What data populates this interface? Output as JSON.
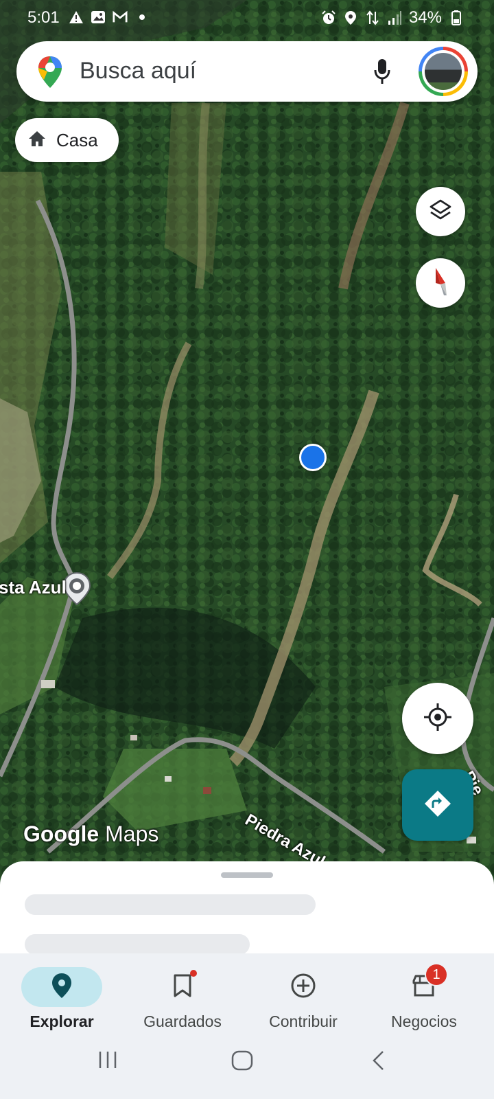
{
  "status_bar": {
    "time": "5:01",
    "battery": "34%",
    "left_icons": [
      "warning-icon",
      "image-icon",
      "gmail-icon",
      "dot-icon"
    ],
    "right_icons": [
      "alarm-icon",
      "location-icon",
      "data-arrows-icon",
      "signal-icon",
      "battery-icon"
    ]
  },
  "search": {
    "placeholder": "Busca aquí"
  },
  "chip": {
    "label": "Casa"
  },
  "map": {
    "place_label": "sta Azul",
    "road_label": "Piedra Azul Alto",
    "road_label_partial": "Pie",
    "watermark_brand": "Google",
    "watermark_product": "Maps"
  },
  "bottom_nav": {
    "items": [
      {
        "label": "Explorar",
        "icon": "explore-pin-icon",
        "active": true
      },
      {
        "label": "Guardados",
        "icon": "bookmark-icon",
        "active": false
      },
      {
        "label": "Contribuir",
        "icon": "add-circle-icon",
        "active": false
      },
      {
        "label": "Negocios",
        "icon": "store-icon",
        "active": false,
        "badge": "1"
      }
    ]
  },
  "colors": {
    "accent": "#0b7a86",
    "user_location": "#1a73e8",
    "badge": "#d93025",
    "active_nav": "#c2e7ef"
  }
}
